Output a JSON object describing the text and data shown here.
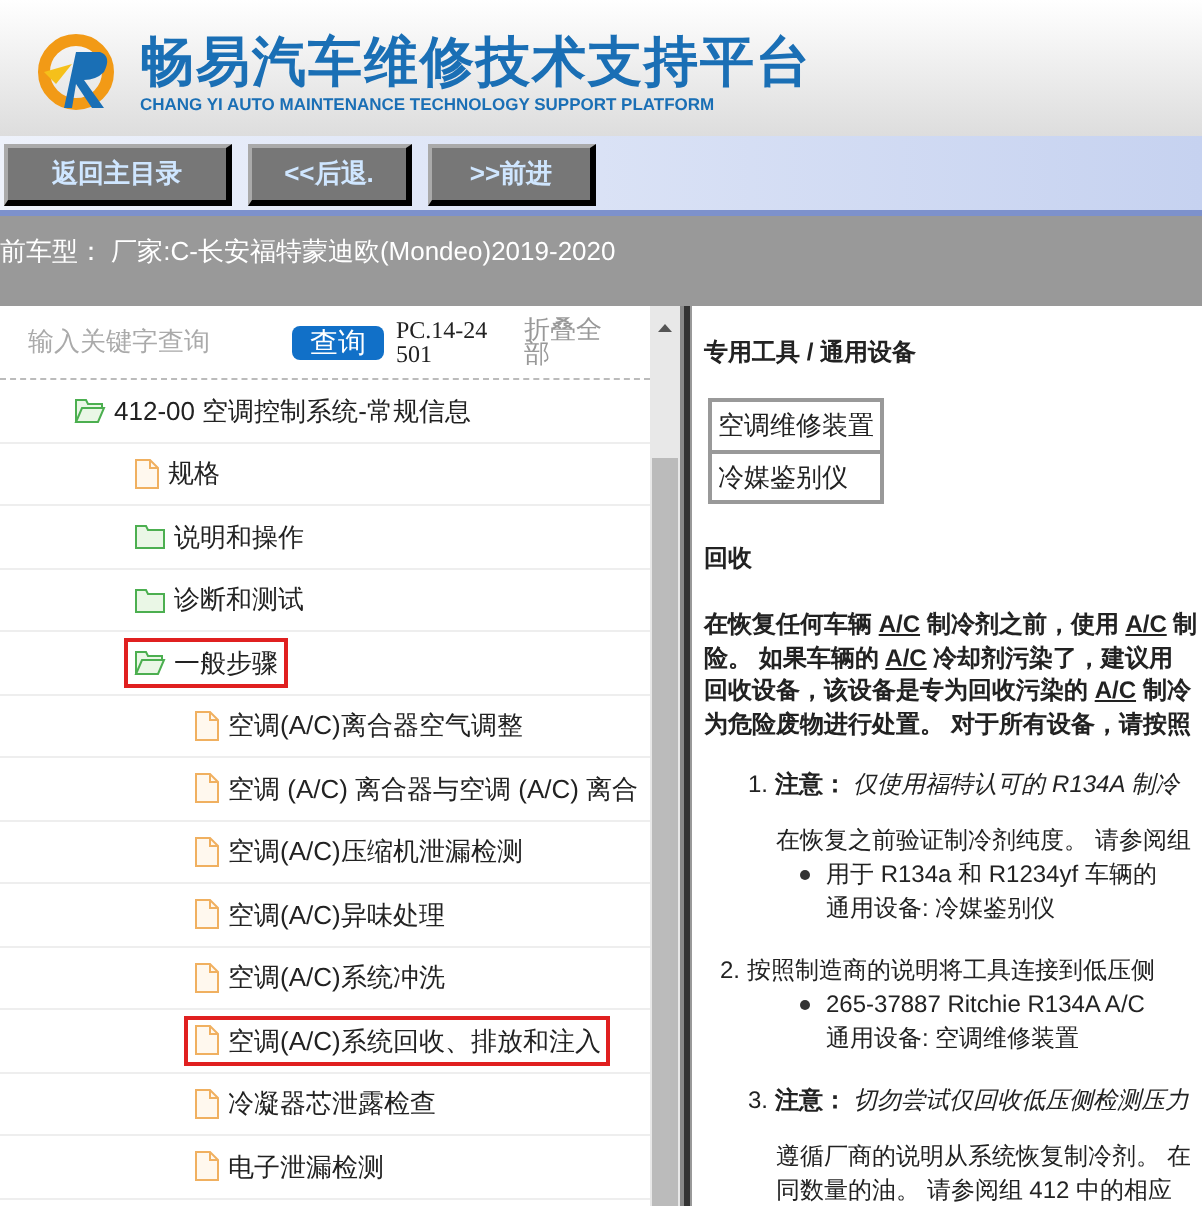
{
  "header": {
    "title": "畅易汽车维修技术支持平台",
    "subtitle": "CHANG YI AUTO MAINTENANCE TECHNOLOGY SUPPORT PLATFORM"
  },
  "nav_buttons": [
    "返回主目录",
    "<<后退.",
    ">>前进"
  ],
  "car_model": "前车型：  厂家:C-长安福特蒙迪欧(Mondeo)2019-2020",
  "search": {
    "placeholder": "输入关键字查询",
    "button": "查询",
    "code": "PC.14-24501",
    "collapse": "折叠全部"
  },
  "tree": [
    {
      "label": "412-00 空调控制系统-常规信息",
      "kind": "folder",
      "expanded": true,
      "highlighted": false,
      "children": [
        {
          "label": "规格",
          "kind": "file",
          "highlighted": false
        },
        {
          "label": "说明和操作",
          "kind": "folder",
          "expanded": false,
          "highlighted": false
        },
        {
          "label": "诊断和测试",
          "kind": "folder",
          "expanded": false,
          "highlighted": false
        },
        {
          "label": "一般步骤",
          "kind": "folder",
          "expanded": true,
          "highlighted": true,
          "children": [
            {
              "label": "空调(A/C)离合器空气调整",
              "kind": "file",
              "highlighted": false
            },
            {
              "label": "空调 (A/C) 离合器与空调 (A/C) 离合",
              "kind": "file",
              "highlighted": false
            },
            {
              "label": "空调(A/C)压缩机泄漏检测",
              "kind": "file",
              "highlighted": false
            },
            {
              "label": "空调(A/C)异味处理",
              "kind": "file",
              "highlighted": false
            },
            {
              "label": "空调(A/C)系统冲洗",
              "kind": "file",
              "highlighted": false
            },
            {
              "label": "空调(A/C)系统回收、排放和注入",
              "kind": "file",
              "highlighted": true
            },
            {
              "label": "冷凝器芯泄露检查",
              "kind": "file",
              "highlighted": false
            },
            {
              "label": "电子泄漏检测",
              "kind": "file",
              "highlighted": false
            }
          ]
        }
      ]
    }
  ],
  "document": {
    "tools_heading": "专用工具 / 通用设备",
    "tools": [
      "空调维修装置",
      "冷媒鉴别仪"
    ],
    "section_heading": "回收",
    "intro_lines": [
      [
        {
          "text": "在恢复任何车辆 ",
          "underline": false
        },
        {
          "text": "A/C",
          "underline": true
        },
        {
          "text": " 制冷剂之前，使用 ",
          "underline": false
        },
        {
          "text": "A/C",
          "underline": true
        },
        {
          "text": " 制",
          "underline": false
        }
      ],
      [
        {
          "text": "险。 如果车辆的 ",
          "underline": false
        },
        {
          "text": "A/C",
          "underline": true
        },
        {
          "text": " 冷却剂污染了，建议用",
          "underline": false
        }
      ],
      [
        {
          "text": "回收设备，该设备是专为回收污染的 ",
          "underline": false
        },
        {
          "text": "A/C",
          "underline": true
        },
        {
          "text": " 制冷",
          "underline": false
        }
      ],
      [
        {
          "text": "为危险废物进行处置。 对于所有设备，请按照",
          "underline": false
        }
      ]
    ],
    "steps": [
      {
        "number": "1.",
        "label": "注意：",
        "note": "仅使用福特认可的 R134A 制冷",
        "text": "在恢复之前验证制冷剂纯度。 请参阅组",
        "bullet": "用于 R134a 和 R1234yf 车辆的",
        "equipment": "通用设备: 冷媒鉴别仪"
      },
      {
        "number": "2.",
        "heading": "按照制造商的说明将工具连接到低压侧",
        "bullet": "265-37887 Ritchie R134A A/C",
        "equipment": "通用设备: 空调维修装置"
      },
      {
        "number": "3.",
        "label": "注意：",
        "note": "切勿尝试仅回收低压侧检测压力",
        "text_lines": [
          "遵循厂商的说明从系统恢复制冷剂。 在",
          "同数量的油。 请参阅组 412 中的相应"
        ]
      }
    ]
  }
}
